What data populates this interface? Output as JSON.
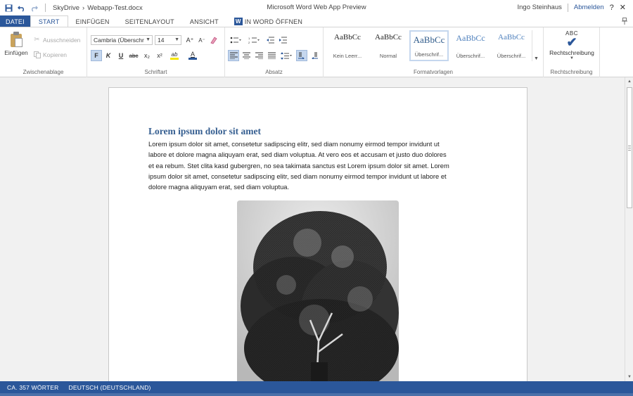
{
  "titlebar": {
    "breadcrumb_root": "SkyDrive",
    "breadcrumb_sep": "›",
    "document_name": "Webapp-Test.docx",
    "app_title": "Microsoft Word Web App Preview",
    "user_name": "Ingo Steinhaus",
    "signout_label": "Abmelden",
    "help_glyph": "?",
    "close_glyph": "✕",
    "icons": [
      "save-icon",
      "undo-icon",
      "redo-icon"
    ]
  },
  "tabs": {
    "file": "DATEI",
    "start": "START",
    "insert": "EINFÜGEN",
    "layout": "SEITENLAYOUT",
    "view": "ANSICHT",
    "open_in_word": "IN WORD ÖFFNEN",
    "word_glyph": "W"
  },
  "ribbon": {
    "clipboard": {
      "paste_label": "Einfügen",
      "cut_label": "Ausschneiden",
      "copy_label": "Kopieren",
      "group_label": "Zwischenablage"
    },
    "font": {
      "font_name": "Cambria (Überschr",
      "font_size": "14",
      "group_label": "Schriftart",
      "bold": "F",
      "italic": "K",
      "underline": "U",
      "strike": "abc",
      "subscript": "x₂",
      "superscript": "x²",
      "grow": "A⁺",
      "shrink": "A⁻",
      "highlight": "ab",
      "font_color": "A"
    },
    "paragraph": {
      "group_label": "Absatz"
    },
    "styles": {
      "group_label": "Formatvorlagen",
      "items": [
        {
          "sample": "AaBbCc",
          "name": "Kein Leerr..."
        },
        {
          "sample": "AaBbCc",
          "name": "Normal"
        },
        {
          "sample": "AaBbCc",
          "name": "Überschrif..."
        },
        {
          "sample": "AaBbCc",
          "name": "Überschrif..."
        },
        {
          "sample": "AaBbCc",
          "name": "Überschrif..."
        }
      ]
    },
    "proofing": {
      "abc": "ABC",
      "check": "✔",
      "label": "Rechtschreibung",
      "group_label": "Rechtschreibung"
    }
  },
  "document": {
    "heading": "Lorem ipsum dolor sit amet",
    "body_lines": [
      "Lorem ipsum dolor sit amet, consetetur sadipscing elitr, sed diam nonumy eirmod tempor invidunt ut",
      "labore et dolore magna aliquyam erat, sed diam voluptua. At vero eos et accusam et justo duo dolores",
      "et ea rebum. Stet clita kasd gubergren, no sea takimata sanctus est Lorem ipsum dolor sit amet. Lorem",
      "ipsum dolor sit amet, consetetur sadipscing elitr, sed diam nonumy eirmod tempor invidunt ut labore et",
      "dolore magna aliquyam erat, sed diam voluptua."
    ]
  },
  "statusbar": {
    "word_count": "CA. 357 WÖRTER",
    "language": "DEUTSCH (DEUTSCHLAND)"
  },
  "colors": {
    "accent": "#2b579a",
    "heading": "#365f91"
  }
}
